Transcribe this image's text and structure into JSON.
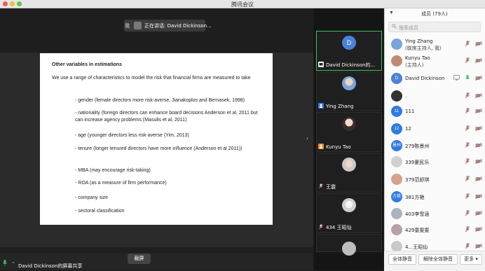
{
  "window": {
    "title": "腾讯会议"
  },
  "speaker_pill": {
    "me": "我",
    "speaking": "正在讲话: David Dickinson..."
  },
  "slide": {
    "title": "Other variables in estimations",
    "intro": "We use a range of characteristics to model the risk that financial firms are measured to take",
    "bullets": [
      "- gender (female directors more risk-averse, Jianakoplos and Bernasek, 1998)",
      "- nationality (foreign directors can enhance board decisions Anderson et al, 2011 but can increase agency problems (Masulis et al, 2011)",
      "- age (younger directors less risk-averse (Yim, 2013)",
      "- tenure (longer tenured directors have more influence (Anderson et al 2011))",
      "- MBA (may encourage risk-taking)",
      "- ROA (as a measure of firm performance)",
      "- company size",
      "- sectoral classification"
    ]
  },
  "bottom_bar": {
    "share_label": "David Dickinson的屏幕共享",
    "screenshot_button": "截屏"
  },
  "video_tiles": [
    {
      "name": "David Dickinson的...",
      "avatar_letter": "D"
    },
    {
      "name": "Ying Zhang"
    },
    {
      "name": "Kunyu Tao"
    },
    {
      "name": "王震"
    },
    {
      "name": "434 王昭仙"
    }
  ],
  "panel": {
    "title": "成员 (79人)",
    "search_placeholder": "搜索成员",
    "members": [
      {
        "name": "Ying Zhang",
        "sub": "(联席主持人, 我)",
        "avatar_text": "",
        "avatar_color": "#7aa5d8"
      },
      {
        "name": "Kunyu Tao",
        "sub": "(主持人)",
        "avatar_text": "",
        "avatar_color": "#c08a7b"
      },
      {
        "name": "David Dickinson",
        "sub": "",
        "avatar_text": "D",
        "avatar_color": "#4a82d6"
      },
      {
        "name": ".",
        "sub": "",
        "avatar_text": "",
        "avatar_color": "#333333"
      },
      {
        "name": "111",
        "sub": "",
        "avatar_text": "11",
        "avatar_color": "#2f7be5"
      },
      {
        "name": "12",
        "sub": "",
        "avatar_text": "12",
        "avatar_color": "#2f7be5"
      },
      {
        "name": "279陈景州",
        "sub": "",
        "avatar_text": "景州",
        "avatar_color": "#2f7be5"
      },
      {
        "name": "339夏民乐",
        "sub": "",
        "avatar_text": "",
        "avatar_color": "#d0d0d0"
      },
      {
        "name": "379范舒琪",
        "sub": "",
        "avatar_text": "",
        "avatar_color": "#d9a08d"
      },
      {
        "name": "381方艳",
        "sub": "",
        "avatar_text": "方艳",
        "avatar_color": "#2f7be5"
      },
      {
        "name": "403李雪涵",
        "sub": "",
        "avatar_text": "",
        "avatar_color": "#a8b4c0"
      },
      {
        "name": "429童雯雯",
        "sub": "",
        "avatar_text": "",
        "avatar_color": "#b7a0a8"
      },
      {
        "name": "4...王昭仙",
        "sub": "",
        "avatar_text": "",
        "avatar_color": "#c9c9c9"
      }
    ],
    "footer": {
      "mute_all": "全体静音",
      "unmute_all": "解除全体静音",
      "more": "更多 ▾"
    }
  },
  "colors": {
    "accent_green": "#3fbf5f",
    "muted_red": "#e0443a",
    "blue_avatar": "#2f7be5"
  }
}
